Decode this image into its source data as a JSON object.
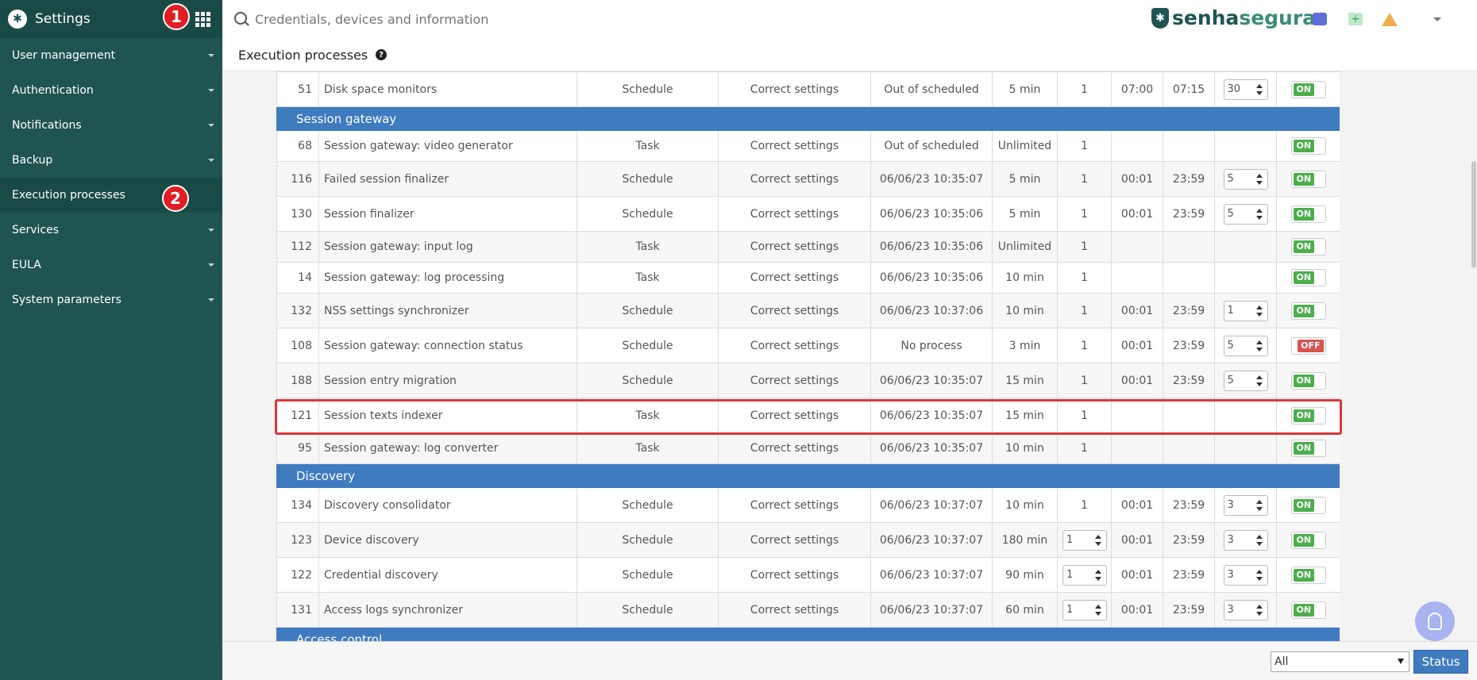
{
  "sidebar": {
    "title": "Settings",
    "items": [
      {
        "label": "User management"
      },
      {
        "label": "Authentication"
      },
      {
        "label": "Notifications"
      },
      {
        "label": "Backup"
      },
      {
        "label": "Execution processes"
      },
      {
        "label": "Services"
      },
      {
        "label": "EULA"
      },
      {
        "label": "System parameters"
      }
    ]
  },
  "badges": {
    "one": "1",
    "two": "2"
  },
  "search": {
    "placeholder": "Credentials, devices and information"
  },
  "brand": {
    "part1": "senha",
    "part2": "segura"
  },
  "page": {
    "title": "Execution processes",
    "help": "?"
  },
  "rows": [
    {
      "id": "51",
      "name": "Disk space monitors",
      "type": "Schedule",
      "settings": "Correct settings",
      "last": "Out of scheduled",
      "interval": "5 min",
      "instances": "1",
      "start": "07:00",
      "end": "07:15",
      "limit": "30",
      "status": "ON"
    },
    {
      "group": "Session gateway"
    },
    {
      "id": "68",
      "name": "Session gateway: video generator",
      "type": "Task",
      "settings": "Correct settings",
      "last": "Out of scheduled",
      "interval": "Unlimited",
      "instances": "1",
      "status": "ON"
    },
    {
      "id": "116",
      "name": "Failed session finalizer",
      "type": "Schedule",
      "settings": "Correct settings",
      "last": "06/06/23 10:35:07",
      "interval": "5 min",
      "instances": "1",
      "start": "00:01",
      "end": "23:59",
      "limit": "5",
      "status": "ON"
    },
    {
      "id": "130",
      "name": "Session finalizer",
      "type": "Schedule",
      "settings": "Correct settings",
      "last": "06/06/23 10:35:06",
      "interval": "5 min",
      "instances": "1",
      "start": "00:01",
      "end": "23:59",
      "limit": "5",
      "status": "ON"
    },
    {
      "id": "112",
      "name": "Session gateway: input log",
      "type": "Task",
      "settings": "Correct settings",
      "last": "06/06/23 10:35:06",
      "interval": "Unlimited",
      "instances": "1",
      "status": "ON"
    },
    {
      "id": "14",
      "name": "Session gateway: log processing",
      "type": "Task",
      "settings": "Correct settings",
      "last": "06/06/23 10:35:06",
      "interval": "10 min",
      "instances": "1",
      "status": "ON"
    },
    {
      "id": "132",
      "name": "NSS settings synchronizer",
      "type": "Schedule",
      "settings": "Correct settings",
      "last": "06/06/23 10:37:06",
      "interval": "10 min",
      "instances": "1",
      "start": "00:01",
      "end": "23:59",
      "limit": "1",
      "status": "ON"
    },
    {
      "id": "108",
      "name": "Session gateway: connection status",
      "type": "Schedule",
      "settings": "Correct settings",
      "last": "No process",
      "interval": "3 min",
      "instances": "1",
      "start": "00:01",
      "end": "23:59",
      "limit": "5",
      "status": "OFF"
    },
    {
      "id": "188",
      "name": "Session entry migration",
      "type": "Schedule",
      "settings": "Correct settings",
      "last": "06/06/23 10:35:07",
      "interval": "15 min",
      "instances": "1",
      "start": "00:01",
      "end": "23:59",
      "limit": "5",
      "status": "ON"
    },
    {
      "id": "121",
      "name": "Session texts indexer",
      "type": "Task",
      "settings": "Correct settings",
      "last": "06/06/23 10:35:07",
      "interval": "15 min",
      "instances": "1",
      "status": "ON"
    },
    {
      "id": "95",
      "name": "Session gateway: log converter",
      "type": "Task",
      "settings": "Correct settings",
      "last": "06/06/23 10:35:07",
      "interval": "10 min",
      "instances": "1",
      "status": "ON"
    },
    {
      "group": "Discovery"
    },
    {
      "id": "134",
      "name": "Discovery consolidator",
      "type": "Schedule",
      "settings": "Correct settings",
      "last": "06/06/23 10:37:07",
      "interval": "10 min",
      "instances": "1",
      "start": "00:01",
      "end": "23:59",
      "limit": "3",
      "status": "ON"
    },
    {
      "id": "123",
      "name": "Device discovery",
      "type": "Schedule",
      "settings": "Correct settings",
      "last": "06/06/23 10:37:07",
      "interval": "180 min",
      "instances": "1",
      "instances_spin": true,
      "start": "00:01",
      "end": "23:59",
      "limit": "3",
      "status": "ON"
    },
    {
      "id": "122",
      "name": "Credential discovery",
      "type": "Schedule",
      "settings": "Correct settings",
      "last": "06/06/23 10:37:07",
      "interval": "90 min",
      "instances": "1",
      "instances_spin": true,
      "start": "00:01",
      "end": "23:59",
      "limit": "3",
      "status": "ON"
    },
    {
      "id": "131",
      "name": "Access logs synchronizer",
      "type": "Schedule",
      "settings": "Correct settings",
      "last": "06/06/23 10:37:07",
      "interval": "60 min",
      "instances": "1",
      "instances_spin": true,
      "start": "00:01",
      "end": "23:59",
      "limit": "3",
      "status": "ON"
    },
    {
      "group": "Access control"
    }
  ],
  "bottom": {
    "filter_value": "All",
    "status_label": "Status"
  },
  "colors": {
    "sidebar_bg": "#1f5450",
    "group_bg": "#3f7bbf",
    "on": "#4cae4c",
    "off": "#d9534f",
    "highlight": "#d9373b",
    "badge": "#e21e25"
  }
}
